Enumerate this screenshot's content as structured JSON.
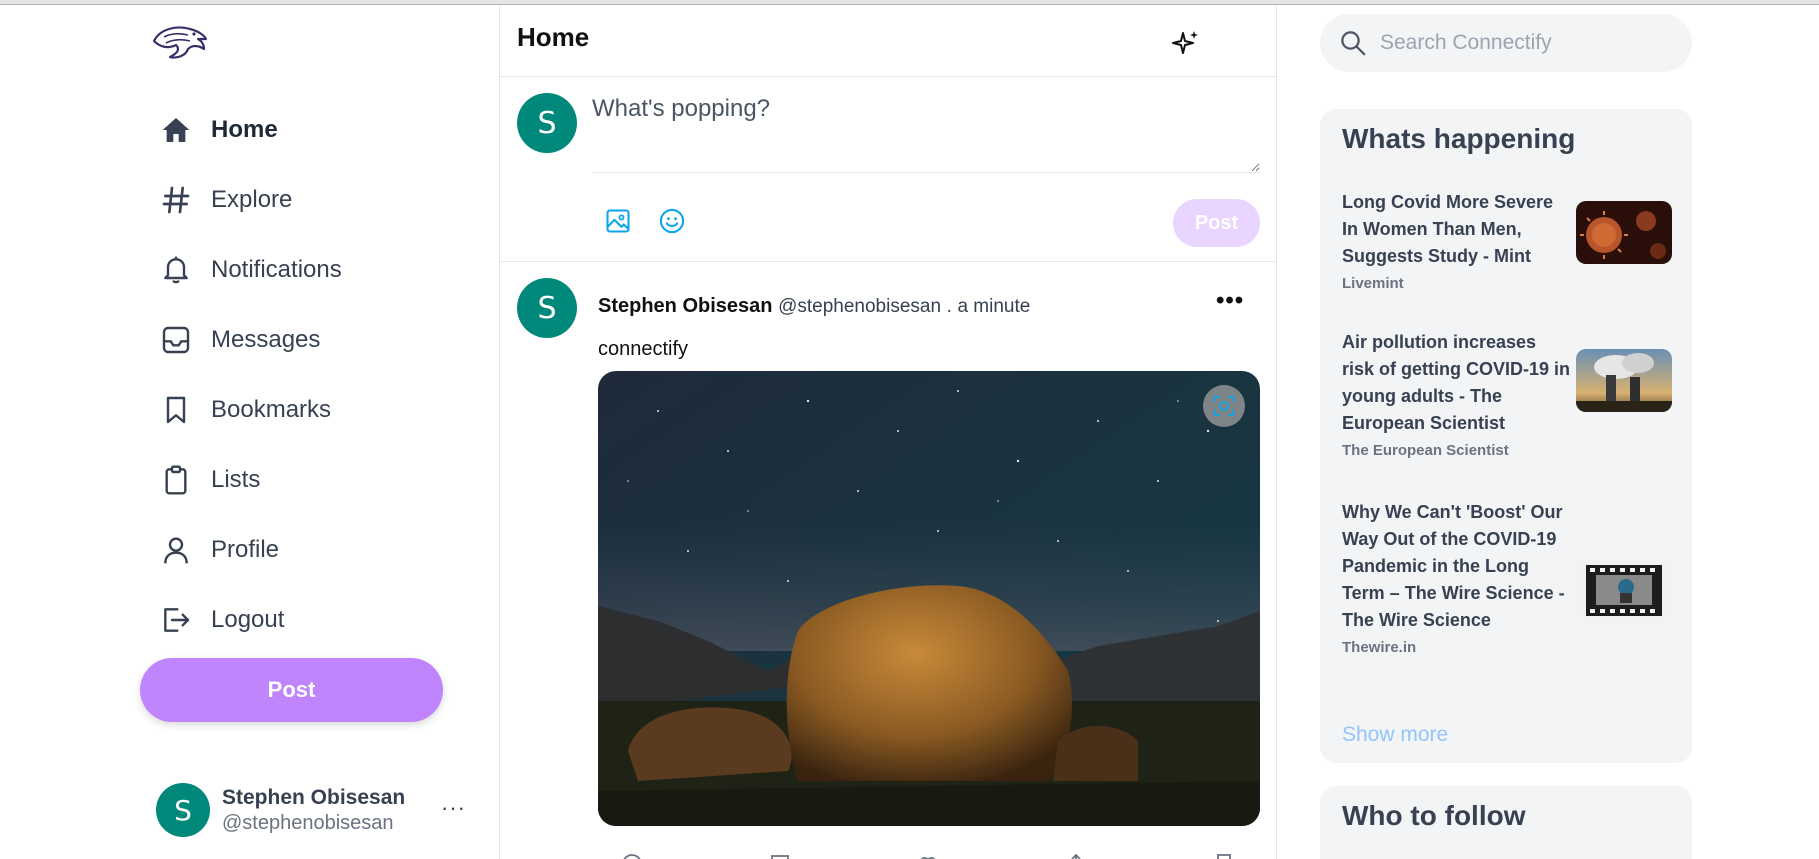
{
  "app": {
    "name": "Connectify"
  },
  "sidebar": {
    "logo": "eagle-logo",
    "items": [
      {
        "label": "Home",
        "icon": "home-icon",
        "active": true
      },
      {
        "label": "Explore",
        "icon": "hashtag-icon",
        "active": false
      },
      {
        "label": "Notifications",
        "icon": "bell-icon",
        "active": false
      },
      {
        "label": "Messages",
        "icon": "inbox-icon",
        "active": false
      },
      {
        "label": "Bookmarks",
        "icon": "bookmark-icon",
        "active": false
      },
      {
        "label": "Lists",
        "icon": "clipboard-icon",
        "active": false
      },
      {
        "label": "Profile",
        "icon": "user-icon",
        "active": false
      },
      {
        "label": "Logout",
        "icon": "logout-icon",
        "active": false
      }
    ],
    "post_label": "Post",
    "profile": {
      "initial": "S",
      "name": "Stephen Obisesan",
      "handle": "@stephenobisesan",
      "more": "···"
    }
  },
  "feed": {
    "title": "Home",
    "composer": {
      "initial": "S",
      "placeholder": "What's popping?",
      "post_label": "Post"
    },
    "posts": [
      {
        "initial": "S",
        "author": "Stephen Obisesan",
        "handle": "@stephenobisesan",
        "separator": ".",
        "time": "a minute",
        "text": "connectify",
        "more": "•••"
      }
    ]
  },
  "right": {
    "search_placeholder": "Search Connectify",
    "whats_title": "Whats happening",
    "news": [
      {
        "title": "Long Covid More Severe In Women Than Men, Suggests Study - Mint",
        "source": "Livemint",
        "thumb": "virus-image"
      },
      {
        "title": "Air pollution increases risk of getting COVID-19 in young adults - The European Scientist",
        "source": "The European Scientist",
        "thumb": "smokestack-image"
      },
      {
        "title": "Why We Can't 'Boost' Our Way Out of the COVID-19 Pandemic in the Long Term – The Wire Science - The Wire Science",
        "source": "Thewire.in",
        "thumb": "film-strip-image"
      }
    ],
    "show_more": "Show more",
    "follow_title": "Who to follow"
  },
  "colors": {
    "accent": "#c084fc",
    "accent_light": "#e9d5ff",
    "avatar": "#00897b",
    "link": "#93c5fd",
    "icon_blue": "#0ea5e9"
  }
}
